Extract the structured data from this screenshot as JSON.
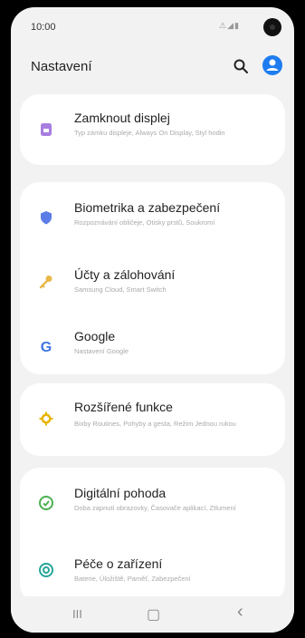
{
  "status": {
    "time": "10:00",
    "icons": "⚠◢▮"
  },
  "header": {
    "title": "Nastavení"
  },
  "items": [
    {
      "label": "Zamknout displej",
      "sub": "Typ zámku displeje, Always On Display, Styl hodin",
      "color": "#a87ee0"
    },
    {
      "label": "Biometrika a zabezpečení",
      "sub": "Rozpoznávání obličeje, Otisky prstů, Soukromí",
      "color": "#5b7de8"
    },
    {
      "label": "Účty a zálohování",
      "sub": "Samsung Cloud, Smart Switch",
      "color": "#e8b84a"
    },
    {
      "label": "Google",
      "sub": "Nastavení Google",
      "color": "#3f74e0"
    },
    {
      "label": "Rozšířené funkce",
      "sub": "Bixby Routines, Pohyby a gesta, Režim Jednou rukou",
      "color": "#e8b400"
    },
    {
      "label": "Digitální pohoda",
      "sub": "Doba zapnutí obrazovky, Časovače aplikací, Ztlumení",
      "color": "#4caf50"
    },
    {
      "label": "Péče o zařízení",
      "sub": "Baterie, Úložiště, Paměť, Zabezpečení",
      "color": "#26a69a"
    }
  ],
  "nav": {
    "recent": "III",
    "home": "▢",
    "back": "‹"
  },
  "colors": {
    "accent": "#1f7cf0"
  }
}
